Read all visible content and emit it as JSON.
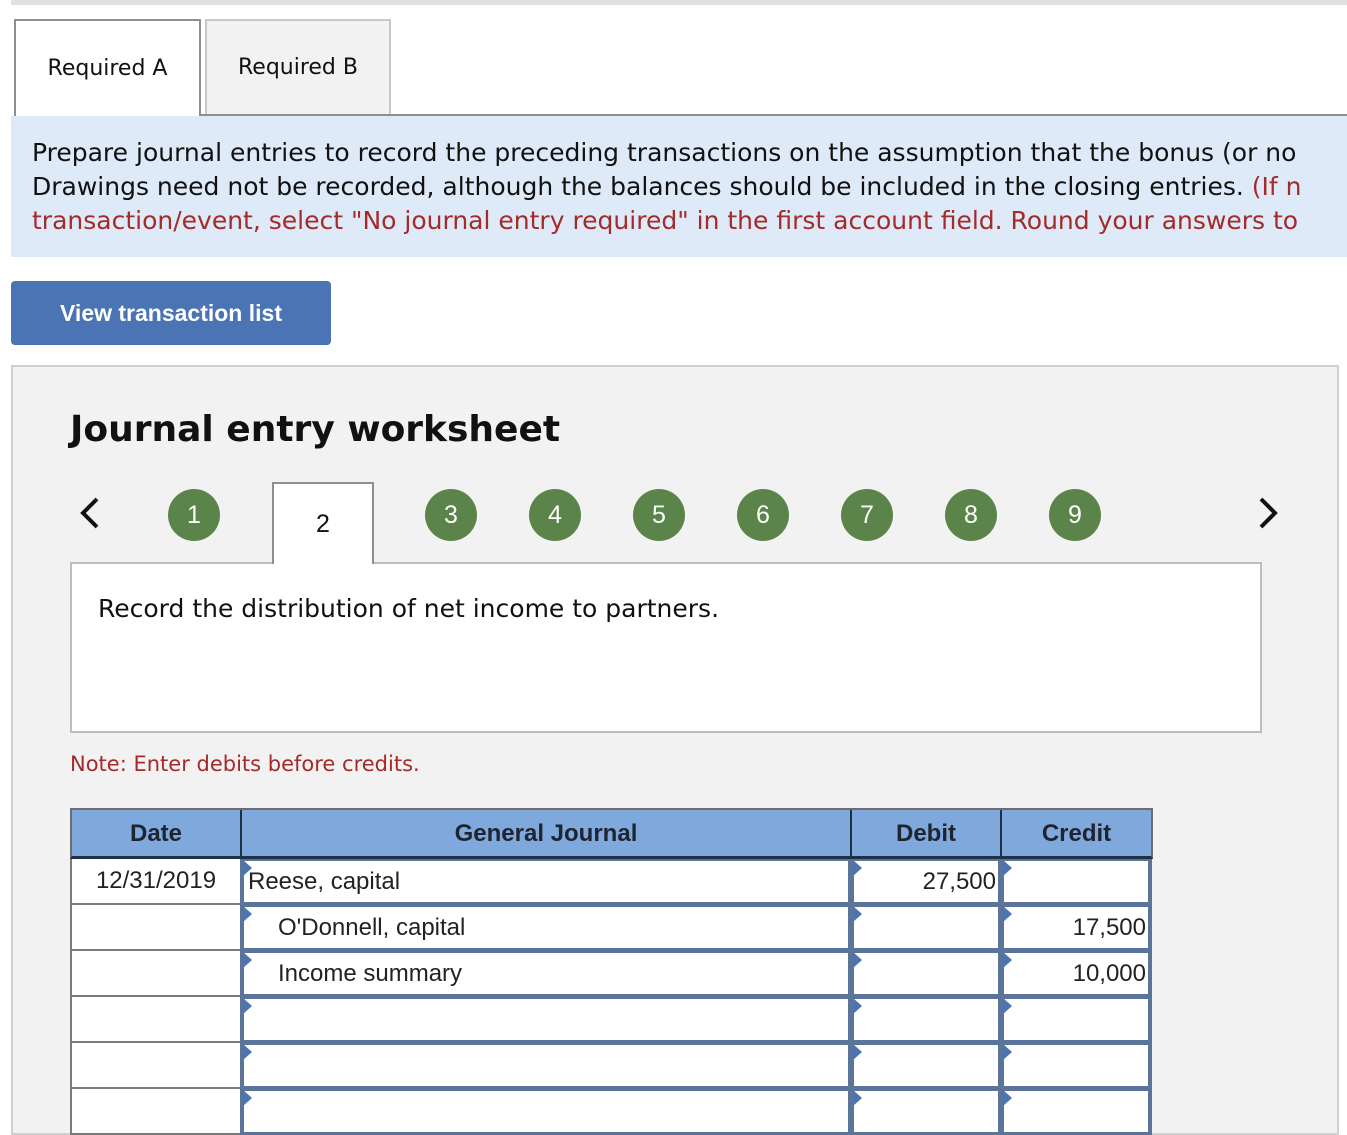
{
  "tabs": [
    {
      "label": "Required A",
      "active": true
    },
    {
      "label": "Required B",
      "active": false
    }
  ],
  "instructions": {
    "line1": "Prepare journal entries to record the preceding transactions on the assumption that the bonus (or no",
    "line2_black": "Drawings need not be recorded, although the balances should be included in the closing entries.",
    "line2_red": " (If n",
    "line3_red": "transaction/event, select \"No journal entry required\" in the first account field. Round your answers to"
  },
  "view_button": "View transaction list",
  "worksheet": {
    "title": "Journal entry worksheet",
    "nav": {
      "prev_icon": "chevron-left-icon",
      "next_icon": "chevron-right-icon"
    },
    "steps": [
      "1",
      "2",
      "3",
      "4",
      "5",
      "6",
      "7",
      "8",
      "9"
    ],
    "active_step": "2",
    "prompt": "Record the distribution of net income to partners.",
    "note": "Note: Enter debits before credits.",
    "colors": {
      "step_green": "#5a8449",
      "header_blue": "#7fa8dd",
      "button_blue": "#4a74b4",
      "note_red": "#a52a2a"
    }
  },
  "journal": {
    "headers": {
      "date": "Date",
      "account": "General Journal",
      "debit": "Debit",
      "credit": "Credit"
    },
    "rows": [
      {
        "date": "12/31/2019",
        "account": "Reese, capital",
        "debit": "27,500",
        "credit": ""
      },
      {
        "date": "",
        "account": "O'Donnell, capital",
        "debit": "",
        "credit": "17,500"
      },
      {
        "date": "",
        "account": "Income summary",
        "debit": "",
        "credit": "10,000"
      },
      {
        "date": "",
        "account": "",
        "debit": "",
        "credit": ""
      },
      {
        "date": "",
        "account": "",
        "debit": "",
        "credit": ""
      },
      {
        "date": "",
        "account": "",
        "debit": "",
        "credit": ""
      }
    ]
  }
}
